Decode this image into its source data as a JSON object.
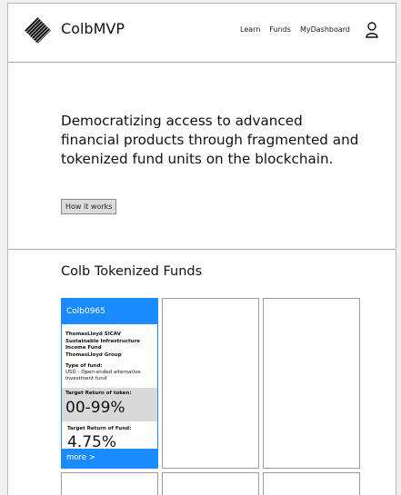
{
  "header": {
    "brand": "ColbMVP",
    "nav": [
      "Learn",
      "Funds",
      "MyDashboard"
    ]
  },
  "hero": {
    "headline": "Democratizing access to advanced financial products through fragmented and tokenized fund units on the blockchain.",
    "button_label": "How it works"
  },
  "funds": {
    "section_title": "Colb Tokenized Funds",
    "featured": {
      "code": "Colb0965",
      "name_lines": [
        "ThomasLloyd SICAV",
        "Sustainable Infrastructure",
        "Income Fund",
        "ThomasLloyd Group"
      ],
      "type_label": "Type of fund:",
      "type_lines": [
        "USD - Open-ended alternative",
        "investment fund"
      ],
      "target_token_label": "Target Return of token:",
      "target_token_value": "00-99%",
      "target_fund_label": "Target Return of Fund:",
      "target_fund_value": "4.75%",
      "more_label": "more >"
    }
  },
  "colors": {
    "accent": "#1a8cff",
    "token_bg": "#d9d9d9"
  },
  "icons": {
    "logo": "diagonal-stripes-diamond-logo",
    "user": "user-icon"
  }
}
